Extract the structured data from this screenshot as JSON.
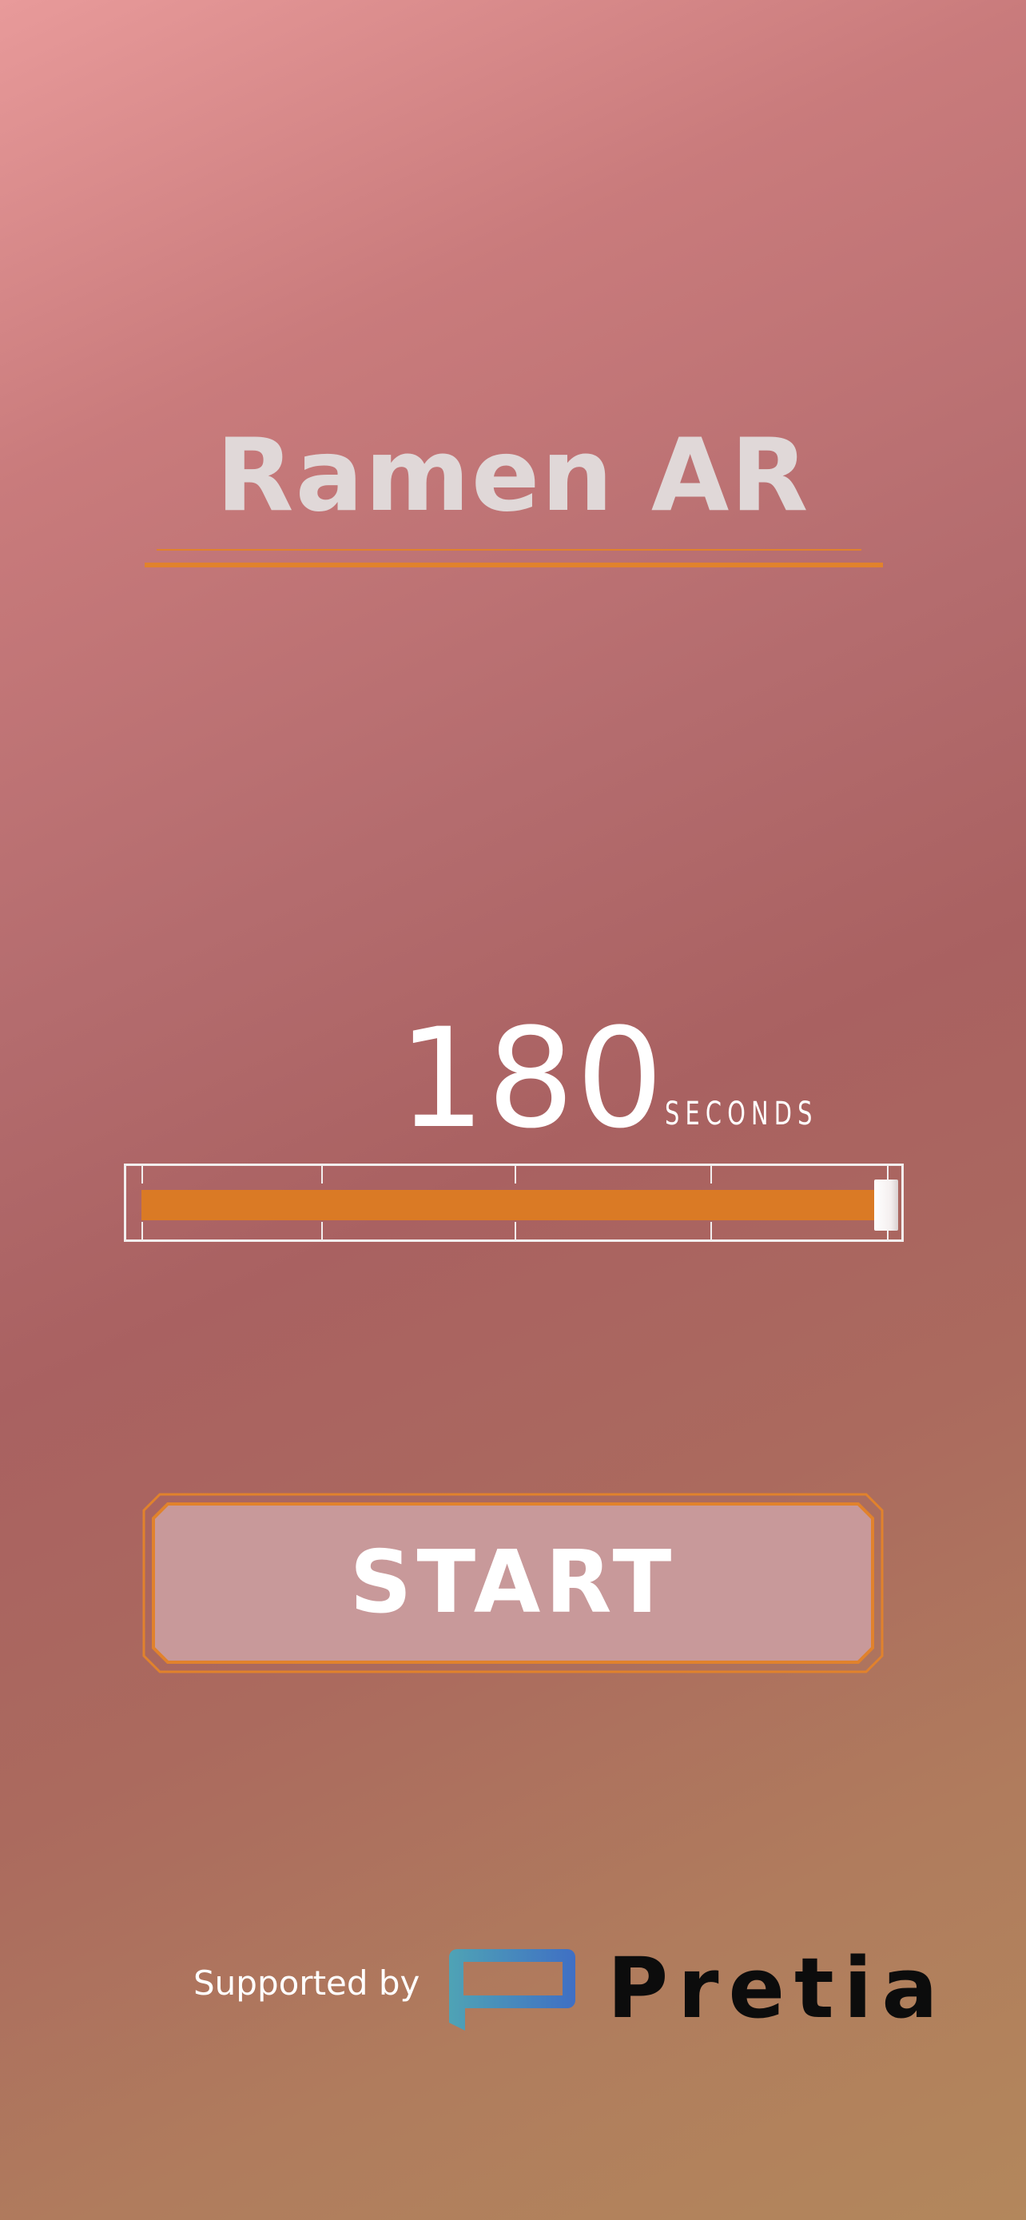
{
  "app": {
    "title": "Ramen AR"
  },
  "timer": {
    "value": "180",
    "unit": "SECONDS",
    "slider_fraction": 1.0,
    "tick_count": 4
  },
  "start_button": {
    "label": "START"
  },
  "footer": {
    "supported_by": "Supported by",
    "brand_name": "Pretia",
    "brand_icon": "pretia-speech-bubble-logo"
  },
  "colors": {
    "accent": "#da7a25",
    "title_text": "#e0d8d8",
    "button_fill": "#c8999a",
    "button_border": "#e1822c",
    "logo_gradient_start": "#4fa3b5",
    "logo_gradient_end": "#3f6fc4"
  }
}
